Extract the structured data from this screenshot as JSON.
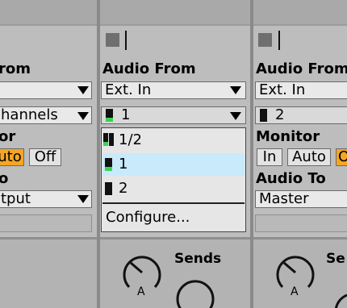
{
  "left": {
    "audio_from_label": "rom",
    "input_type": "",
    "input_channel": "hannels",
    "monitor_label": "or",
    "monitor_auto": "uto",
    "monitor_off": "Off",
    "audio_to_label": "o",
    "output": "tput"
  },
  "center": {
    "audio_from_label": "Audio From",
    "input_type": "Ext. In",
    "input_channel": "1",
    "menu_items": [
      "1/2",
      "1",
      "2"
    ],
    "selected_item": "1",
    "configure": "Configure..."
  },
  "right": {
    "audio_from_label": "Audio From",
    "input_type": "Ext. In",
    "input_channel": "2",
    "monitor_label": "Monitor",
    "monitor_in": "In",
    "monitor_auto": "Auto",
    "monitor_cut": "O",
    "audio_to_label": "Audio To",
    "output": "Master"
  },
  "sends": {
    "label_center": "Sends",
    "label_right": "Se",
    "knob_letter": "A"
  },
  "colors": {
    "accent_orange": "#f5a623",
    "selection_blue": "#c8eafb",
    "meter_green": "#39d353"
  }
}
